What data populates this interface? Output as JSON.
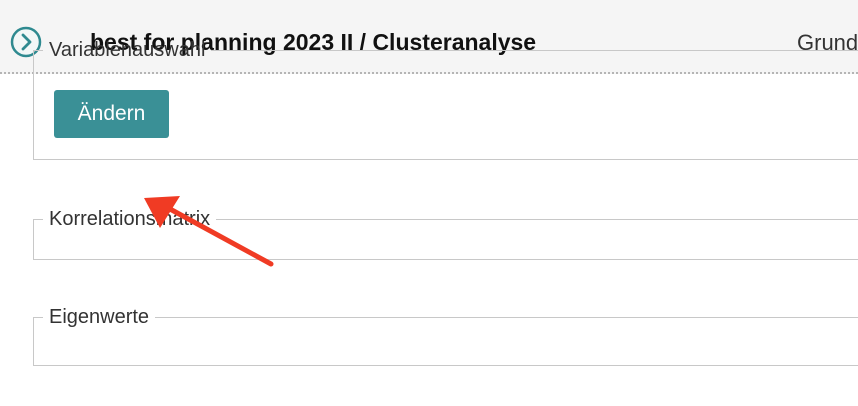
{
  "header": {
    "title": "best for planning 2023 II / Clusteranalyse",
    "right_text": "Grund",
    "nav_icon": "chevron-right-circle-icon"
  },
  "sections": {
    "variablenauswahl": {
      "legend": "Variablenauswahl",
      "button_label": "Ändern"
    },
    "korrelationsmatrix": {
      "legend": "Korrelationsmatrix"
    },
    "eigenwerte": {
      "legend": "Eigenwerte"
    }
  },
  "annotation": {
    "arrow_icon": "red-pointer-arrow",
    "color": "#f03b24"
  },
  "colors": {
    "accent": "#3a9096",
    "nav_icon": "#2f8a90",
    "header_bg": "#f5f5f5"
  }
}
